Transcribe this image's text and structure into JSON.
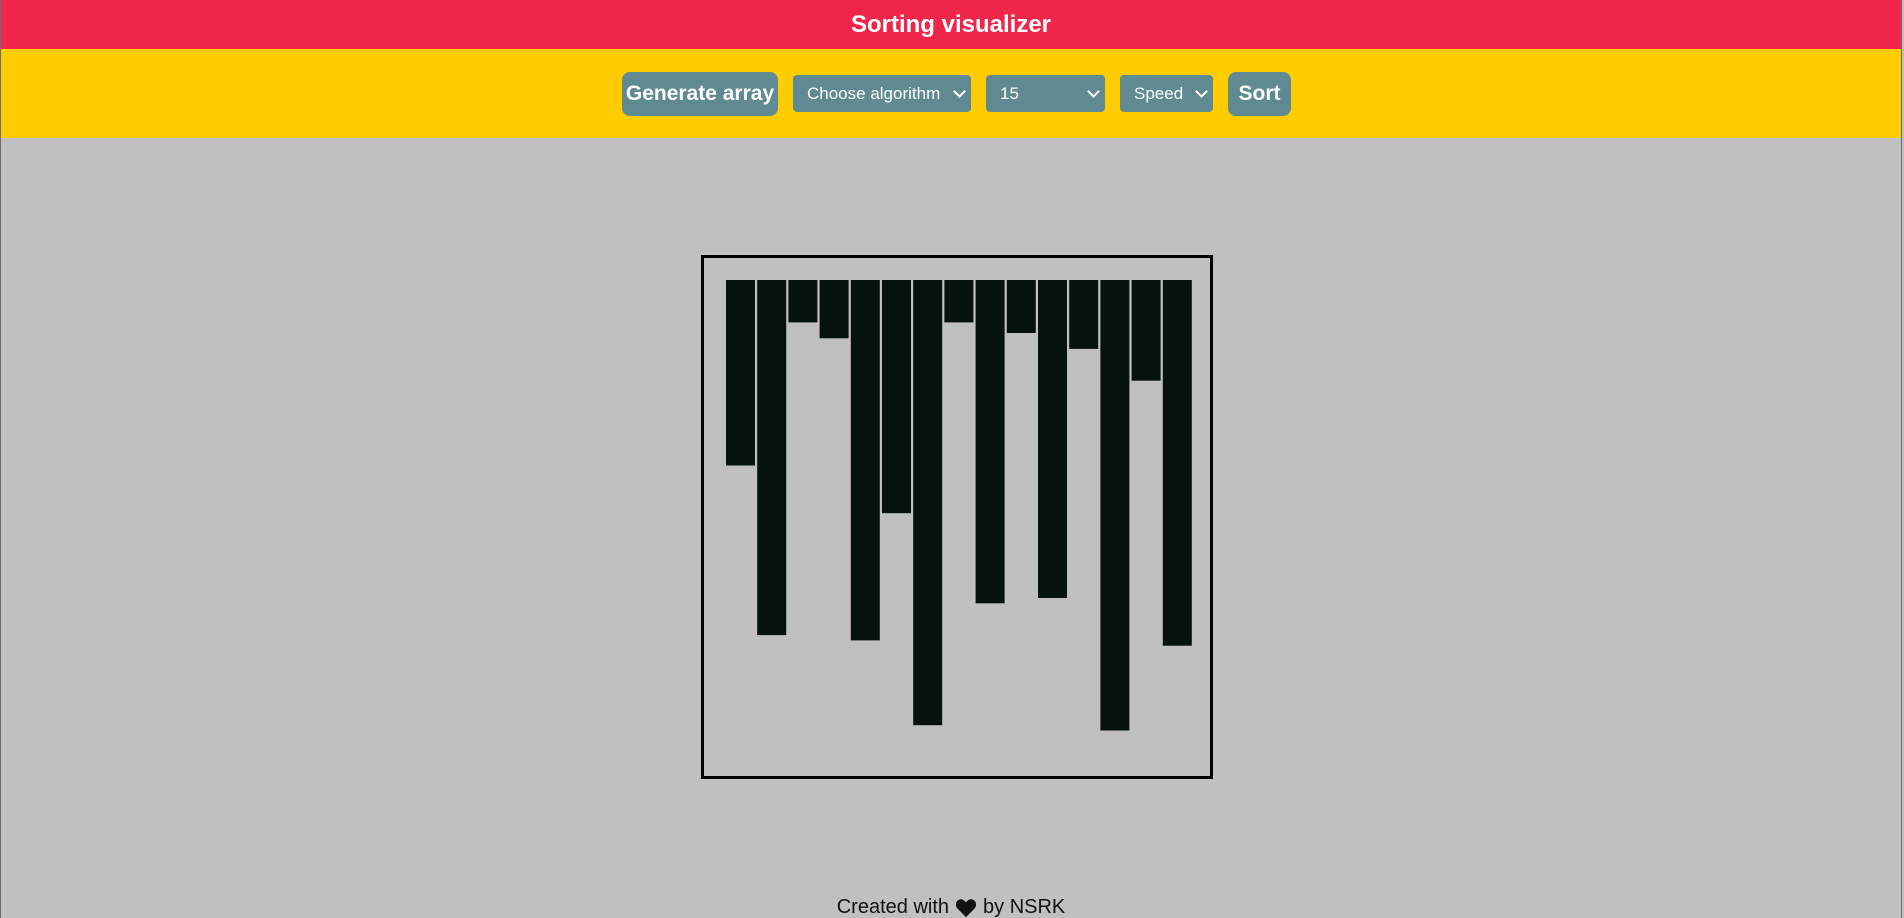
{
  "header": {
    "title": "Sorting visualizer",
    "bg_color": "#f0254b"
  },
  "toolbar": {
    "bg_color": "#ffcc00",
    "accent_color": "#5f8a91",
    "generate_label": "Generate array",
    "algorithm_select": "Choose algorithm",
    "size_select": "15",
    "speed_select": "Speed",
    "sort_label": "Sort"
  },
  "chart_data": {
    "type": "bar",
    "orientation": "hanging-from-top",
    "bar_color": "#06120d",
    "ylim": [
      0,
      100
    ],
    "values": [
      35,
      67,
      8,
      11,
      68,
      44,
      84,
      8,
      61,
      10,
      60,
      13,
      85,
      19,
      69
    ]
  },
  "footer": {
    "prefix": "Created with",
    "icon": "heart-icon",
    "suffix": "by NSRK"
  }
}
